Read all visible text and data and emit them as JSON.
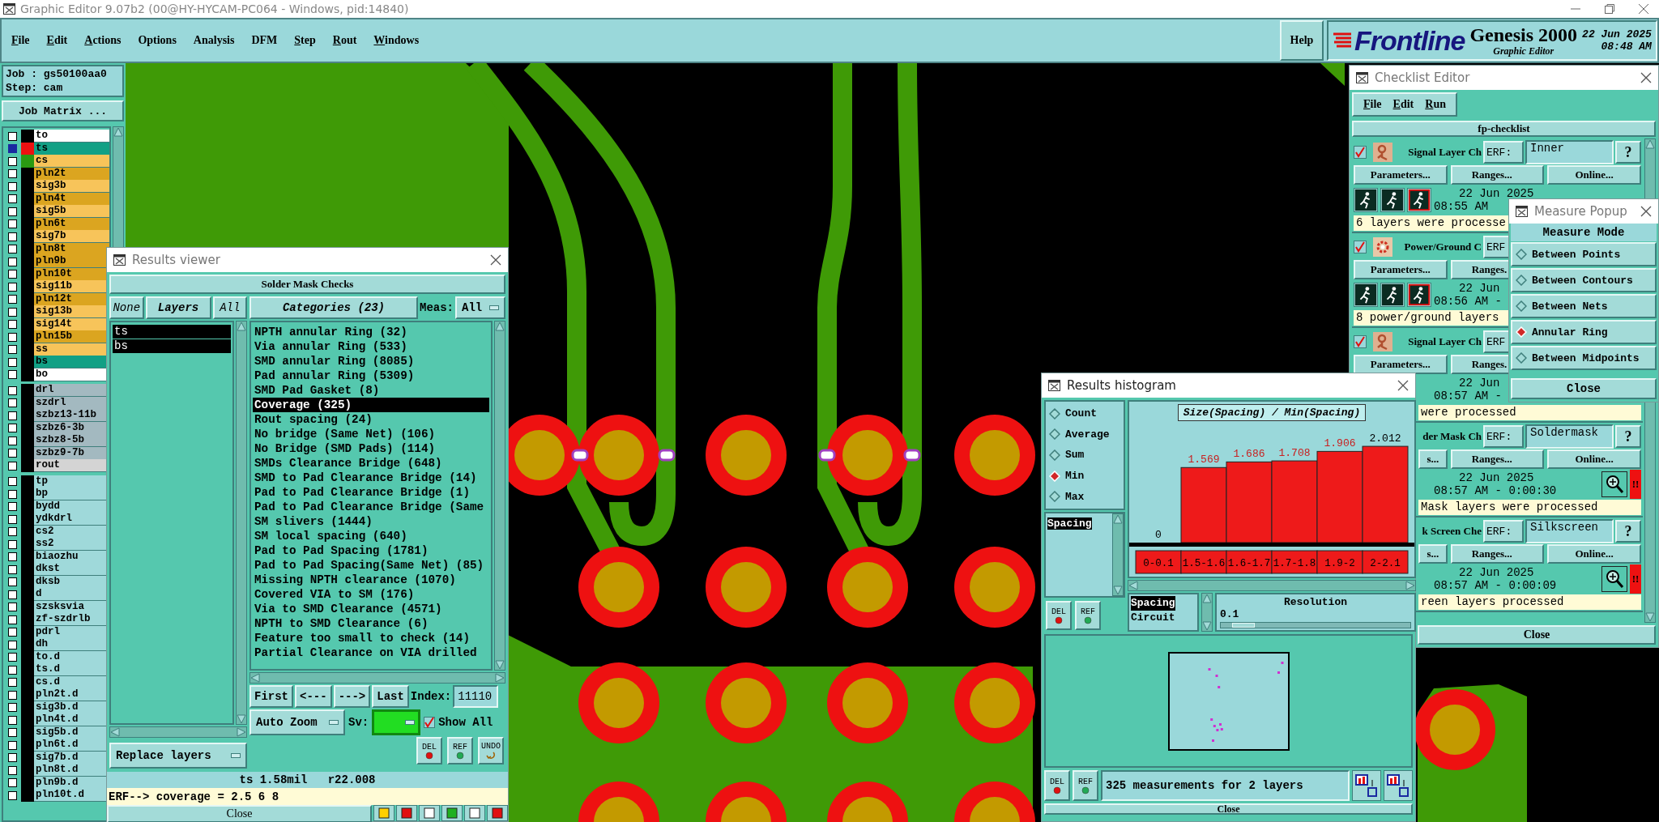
{
  "window": {
    "title": "Graphic Editor 9.07b2 (00@HY-HYCAM-PC064 - Windows, pid:14840)"
  },
  "menu": [
    {
      "label": "File",
      "underlined": true
    },
    {
      "label": "Edit",
      "underlined": true
    },
    {
      "label": "Actions",
      "underlined": true
    },
    {
      "label": "Options",
      "underlined": false
    },
    {
      "label": "Analysis",
      "underlined": false
    },
    {
      "label": "DFM",
      "underlined": false
    },
    {
      "label": "Step",
      "underlined": true
    },
    {
      "label": "Rout",
      "underlined": true
    },
    {
      "label": "Windows",
      "underlined": true
    }
  ],
  "help": "Help",
  "brand": {
    "logo": "Frontline",
    "product": "Genesis 2000",
    "subtitle": "Graphic Editor",
    "date": "22 Jun 2025",
    "time": "08:48 AM"
  },
  "job": {
    "job": "Job : gs50100aa0",
    "step": "Step: cam",
    "matrix_button": "Job Matrix ..."
  },
  "layer_groups": [
    [
      {
        "name": "to",
        "color": "#ffffff",
        "focused": false
      },
      {
        "name": "ts",
        "color": "#12a085",
        "swatch": {
          "color": "#ee1111"
        },
        "focused": true
      },
      {
        "name": "cs",
        "color": "#f7c45a",
        "swatch": {
          "color": "#2a9a12"
        },
        "focused": false
      },
      {
        "name": "pln2t",
        "color": "#dba520",
        "focused": false
      },
      {
        "name": "sig3b",
        "color": "#f7c45a",
        "focused": false
      },
      {
        "name": "pln4t",
        "color": "#dba520",
        "focused": false
      },
      {
        "name": "sig5b",
        "color": "#f7c45a",
        "focused": false
      },
      {
        "name": "pln6t",
        "color": "#dba520",
        "focused": false
      },
      {
        "name": "sig7b",
        "color": "#f7c45a",
        "focused": false
      },
      {
        "name": "pln8t",
        "color": "#dba520",
        "focused": false
      },
      {
        "name": "pln9b",
        "color": "#dba520",
        "focused": false
      },
      {
        "name": "pln10t",
        "color": "#dba520",
        "focused": false
      },
      {
        "name": "sig11b",
        "color": "#f7c45a",
        "focused": false
      },
      {
        "name": "pln12t",
        "color": "#dba520",
        "focused": false
      },
      {
        "name": "sig13b",
        "color": "#f7c45a",
        "focused": false
      },
      {
        "name": "sig14t",
        "color": "#f7c45a",
        "focused": false
      },
      {
        "name": "pln15b",
        "color": "#dba520",
        "focused": false
      },
      {
        "name": "ss",
        "color": "#f7c45a",
        "focused": false
      },
      {
        "name": "bs",
        "color": "#12a085",
        "focused": false
      },
      {
        "name": "bo",
        "color": "#ffffff",
        "focused": false
      }
    ],
    [
      {
        "name": "drl",
        "color": "#a3b9c0",
        "focused": false
      },
      {
        "name": "szdrl",
        "color": "#a3b9c0",
        "focused": false
      },
      {
        "name": "szbz13-11b",
        "color": "#a3b9c0",
        "focused": false
      },
      {
        "name": "szbz6-3b",
        "color": "#a3b9c0",
        "focused": false
      },
      {
        "name": "szbz8-5b",
        "color": "#a3b9c0",
        "focused": false
      },
      {
        "name": "szbz9-7b",
        "color": "#a3b9c0",
        "focused": false
      },
      {
        "name": "rout",
        "color": "#d4d4d4",
        "focused": false
      }
    ],
    [
      {
        "name": "tp",
        "color": "#9fd9da",
        "focused": false
      },
      {
        "name": "bp",
        "color": "#9fd9da",
        "focused": false
      },
      {
        "name": "bydd",
        "color": "#9fd9da",
        "focused": false
      },
      {
        "name": "ydkdrl",
        "color": "#9fd9da",
        "focused": false
      },
      {
        "name": "cs2",
        "color": "#9fd9da",
        "focused": false
      },
      {
        "name": "ss2",
        "color": "#9fd9da",
        "focused": false
      },
      {
        "name": "biaozhu",
        "color": "#9fd9da",
        "focused": false
      },
      {
        "name": "dkst",
        "color": "#9fd9da",
        "focused": false
      },
      {
        "name": "dksb",
        "color": "#9fd9da",
        "focused": false
      },
      {
        "name": "d",
        "color": "#9fd9da",
        "focused": false
      },
      {
        "name": "szsksvia",
        "color": "#9fd9da",
        "focused": false
      },
      {
        "name": "zf-szdrlb",
        "color": "#9fd9da",
        "focused": false
      },
      {
        "name": "pdrl",
        "color": "#9fd9da",
        "focused": false
      },
      {
        "name": "dh",
        "color": "#9fd9da",
        "focused": false
      },
      {
        "name": "to.d",
        "color": "#9fd9da",
        "focused": false
      },
      {
        "name": "ts.d",
        "color": "#9fd9da",
        "focused": false
      },
      {
        "name": "cs.d",
        "color": "#9fd9da",
        "focused": false
      },
      {
        "name": "pln2t.d",
        "color": "#9fd9da",
        "focused": false
      },
      {
        "name": "sig3b.d",
        "color": "#9fd9da",
        "focused": false
      },
      {
        "name": "pln4t.d",
        "color": "#9fd9da",
        "focused": false
      },
      {
        "name": "sig5b.d",
        "color": "#9fd9da",
        "focused": false
      },
      {
        "name": "pln6t.d",
        "color": "#9fd9da",
        "focused": false
      },
      {
        "name": "sig7b.d",
        "color": "#9fd9da",
        "focused": false
      },
      {
        "name": "pln8t.d",
        "color": "#9fd9da",
        "focused": false
      },
      {
        "name": "pln9b.d",
        "color": "#9fd9da",
        "focused": false
      },
      {
        "name": "pln10t.d",
        "color": "#9fd9da",
        "focused": false
      }
    ]
  ],
  "results_viewer": {
    "title": "Results viewer",
    "header": "Solder Mask Checks",
    "layer_buttons": [
      "None",
      "Layers",
      "All"
    ],
    "layers": [
      {
        "name": "ts",
        "selected": true
      },
      {
        "name": "bs",
        "selected": true
      }
    ],
    "categories_button": "Categories (23)",
    "meas_label": "Meas:",
    "meas_value": "All",
    "categories": [
      {
        "label": "NPTH annular Ring (32)",
        "selected": false
      },
      {
        "label": "Via annular Ring (533)",
        "selected": false
      },
      {
        "label": "SMD annular Ring (8085)",
        "selected": false
      },
      {
        "label": "Pad annular Ring (5309)",
        "selected": false
      },
      {
        "label": "SMD Pad Gasket (8)",
        "selected": false
      },
      {
        "label": "Coverage (325)",
        "selected": true
      },
      {
        "label": "Rout spacing (24)",
        "selected": false
      },
      {
        "label": "No bridge (Same Net) (106)",
        "selected": false
      },
      {
        "label": "No Bridge (SMD Pads) (114)",
        "selected": false
      },
      {
        "label": "SMDs Clearance Bridge (648)",
        "selected": false
      },
      {
        "label": "SMD to Pad Clearance Bridge (14)",
        "selected": false
      },
      {
        "label": "Pad to Pad Clearance Bridge (1)",
        "selected": false
      },
      {
        "label": "Pad to Pad Clearance Bridge (Same",
        "selected": false
      },
      {
        "label": "SM slivers (1444)",
        "selected": false
      },
      {
        "label": "SM local spacing (640)",
        "selected": false
      },
      {
        "label": "Pad to Pad Spacing (1781)",
        "selected": false
      },
      {
        "label": "Pad to Pad Spacing(Same Net) (85)",
        "selected": false
      },
      {
        "label": "Missing NPTH clearance (1070)",
        "selected": false
      },
      {
        "label": "Covered VIA to SM (176)",
        "selected": false
      },
      {
        "label": "Via to SMD Clearance (4571)",
        "selected": false
      },
      {
        "label": "NPTH to SMD Clearance (6)",
        "selected": false
      },
      {
        "label": "Feature too small to check (14)",
        "selected": false
      },
      {
        "label": "Partial Clearance on VIA drilled",
        "selected": false
      }
    ],
    "nav": [
      "First",
      "<---",
      "--->",
      "Last"
    ],
    "index_label": "Index:",
    "index_value": "11110",
    "zoom_mode": "Auto Zoom",
    "sv_label": "Sv:",
    "show_all": {
      "label": "Show All",
      "checked": true
    },
    "replace_layers": "Replace layers",
    "actions": [
      {
        "label": "DEL",
        "kind": "del"
      },
      {
        "label": "REF",
        "kind": "ref"
      },
      {
        "label": "UNDO",
        "kind": "undo"
      }
    ],
    "status": "ts 1.58mil   r22.008",
    "erf_line": "ERF--> coverage = 2.5 6 8",
    "close": "Close"
  },
  "results_histogram": {
    "title": "Results histogram",
    "modes": [
      {
        "label": "Count",
        "selected": false
      },
      {
        "label": "Average",
        "selected": false
      },
      {
        "label": "Sum",
        "selected": false
      },
      {
        "label": "Min",
        "selected": true
      },
      {
        "label": "Max",
        "selected": false
      }
    ],
    "attributes": [
      {
        "label": "Spacing",
        "selected": true
      }
    ],
    "actions": [
      {
        "label": "DEL",
        "kind": "del"
      },
      {
        "label": "REF",
        "kind": "ref"
      }
    ],
    "chart_data": {
      "type": "bar",
      "title": "Size(Spacing) / Min(Spacing)",
      "categories": [
        "0-0.1",
        "1.5-1.6",
        "1.6-1.7",
        "1.7-1.8",
        "1.9-2",
        "2-2.1"
      ],
      "values": [
        0,
        1.569,
        1.686,
        1.708,
        1.906,
        2.012
      ],
      "data_labels": true
    },
    "fields": [
      {
        "label": "Spacing",
        "selected": true
      },
      {
        "label": "Circuit",
        "selected": false
      }
    ],
    "resolution_label": "Resolution",
    "resolution_value": "0.1",
    "resolution_slider": {
      "level": 0.06
    },
    "bottom_actions": [
      {
        "label": "DEL",
        "kind": "del"
      },
      {
        "label": "REF",
        "kind": "ref"
      }
    ],
    "summary": "325 measurements for 2 layers",
    "close": "Close"
  },
  "checklist_editor": {
    "title": "Checklist Editor",
    "menu": [
      "File",
      "Edit",
      "Run"
    ],
    "checklist": "fp-checklist",
    "actions": [
      {
        "enabled": true,
        "kind": "signal",
        "name": "Signal Layer Ch",
        "erf": "ERF:",
        "erf_value": "Inner",
        "help": "?",
        "buttons": [
          "Parameters...",
          "Ranges...",
          "Online..."
        ],
        "run_icons": [
          {
            "kind": "run"
          },
          {
            "kind": "run"
          },
          {
            "kind": "run_failed"
          }
        ],
        "date": "22 Jun 2025",
        "time": "08:55 AM",
        "message": "6 layers were processe",
        "clipped_left": false
      },
      {
        "enabled": true,
        "kind": "power",
        "name": "Power/Ground C",
        "erf": "ERF",
        "buttons": [
          "Parameters...",
          "Ranges."
        ],
        "run_icons": [
          {
            "kind": "run"
          },
          {
            "kind": "run"
          },
          {
            "kind": "run_failed"
          }
        ],
        "date": "22 Jun",
        "time": "08:56 AM -",
        "message": "8 power/ground layers",
        "clipped_left": false
      },
      {
        "enabled": true,
        "kind": "signal",
        "name": "Signal Layer Ch",
        "erf": "ERF",
        "buttons": [
          "Parameters...",
          "Ranges."
        ],
        "date": "22 Jun",
        "time": "08:57 AM -",
        "message": "were processed",
        "clipped_left": true
      },
      {
        "name": "der Mask Ch",
        "erf": "ERF:",
        "erf_value": "Soldermask",
        "help": "?",
        "buttons": [
          "s...",
          "Ranges...",
          "Online..."
        ],
        "date": "22 Jun 2025",
        "time": "08:57 AM - 0:00:30",
        "zoom": true,
        "alert": "!!",
        "message": "Mask layers were processed",
        "clipped_left": true
      },
      {
        "name": "k Screen Che",
        "erf": "ERF:",
        "erf_value": "Silkscreen",
        "help": "?",
        "buttons": [
          "s...",
          "Ranges...",
          "Online..."
        ],
        "date": "22 Jun 2025",
        "time": "08:57 AM - 0:00:09",
        "zoom": true,
        "alert": "!!",
        "message": "reen layers processed",
        "clipped_left": true
      }
    ],
    "close": "Close"
  },
  "measure_popup": {
    "title": "Measure Popup",
    "header": "Measure Mode",
    "modes": [
      {
        "label": "Between Points",
        "selected": false
      },
      {
        "label": "Between Contours",
        "selected": false
      },
      {
        "label": "Between Nets",
        "selected": false
      },
      {
        "label": "Annular Ring",
        "selected": true
      },
      {
        "label": "Between Midpoints",
        "selected": false
      }
    ],
    "close": "Close"
  }
}
